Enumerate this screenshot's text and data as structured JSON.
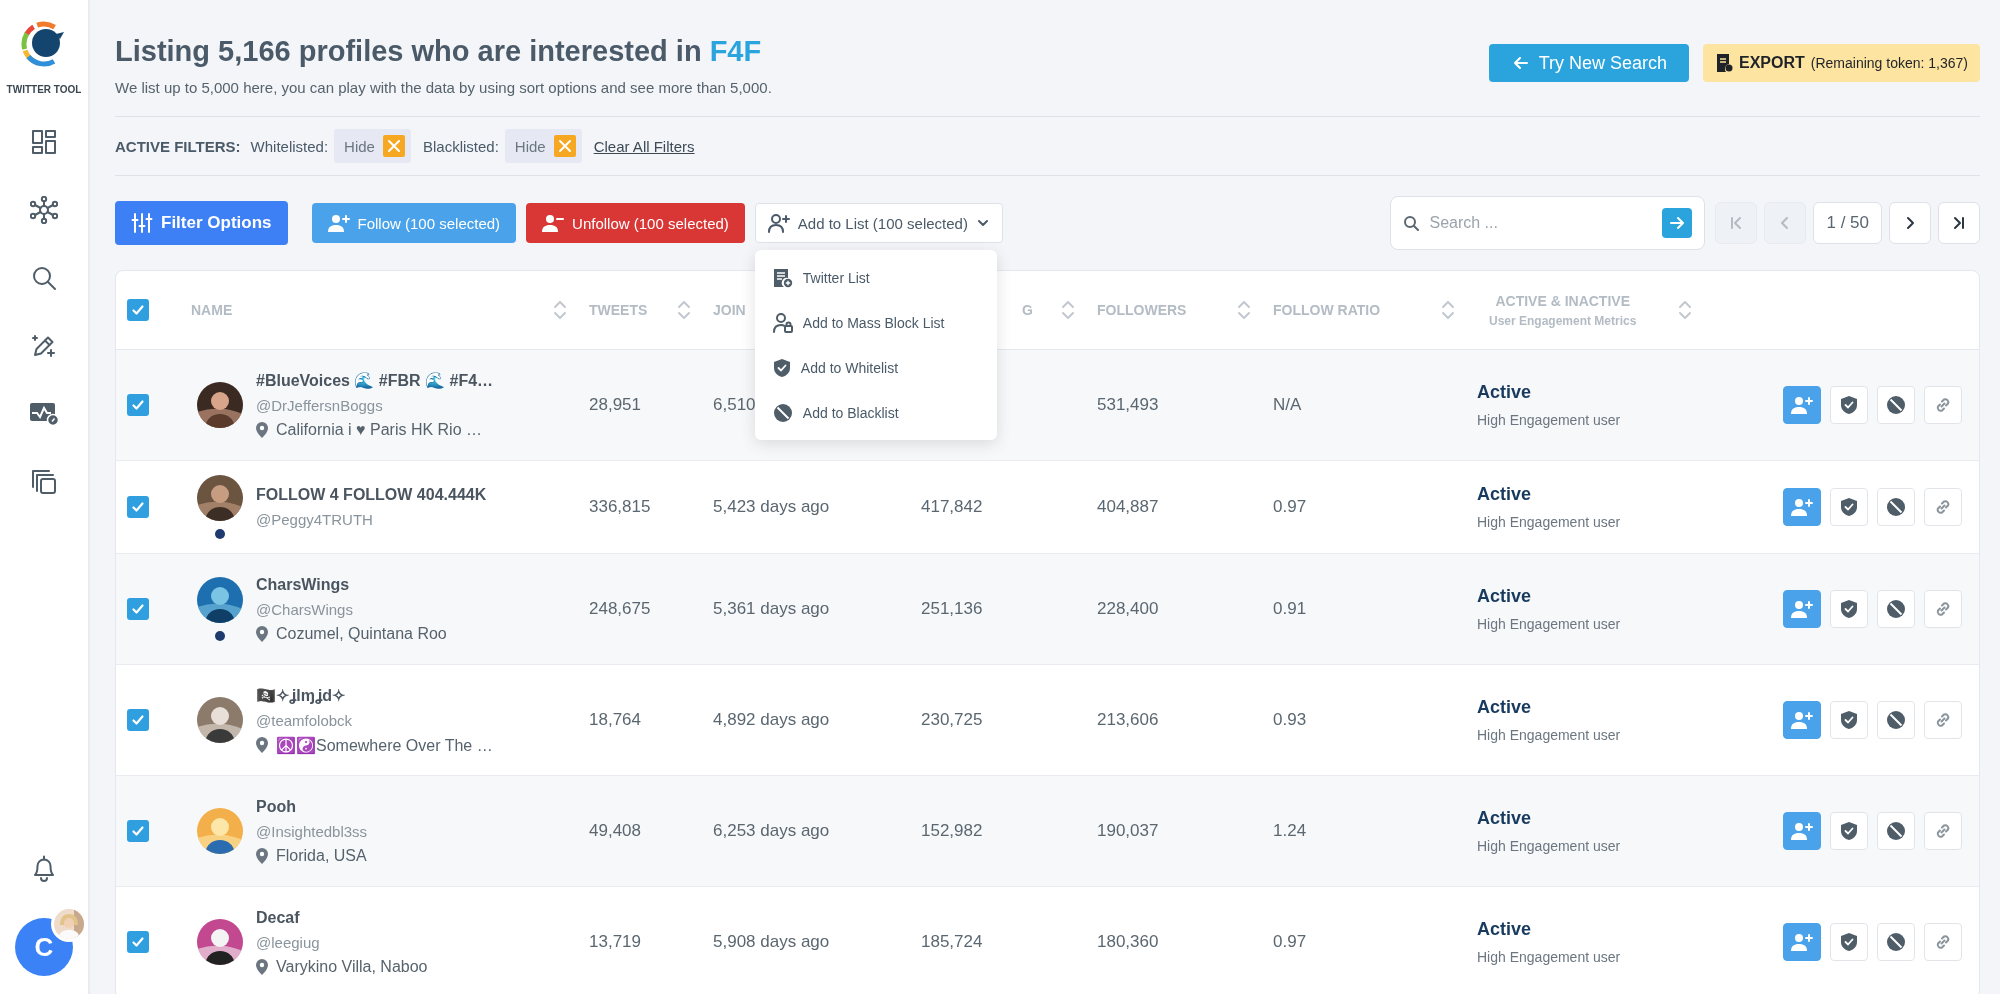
{
  "sidebar": {
    "logo_text": "TWITTER TOOL",
    "user": {
      "initial": "C"
    }
  },
  "header": {
    "title": "Listing 5,166 profiles who are interested in **F4F**",
    "subtitle": "We list up to 5,000 here, you can play with the data by using sort options and see more than 5,000.",
    "try_new_search": "Try New Search",
    "export": {
      "label": "EXPORT",
      "note": "(Remaining token: 1,367)"
    }
  },
  "filters": {
    "label": "ACTIVE FILTERS:",
    "items": [
      {
        "name": "Whitelisted:",
        "value": "Hide"
      },
      {
        "name": "Blacklisted:",
        "value": "Hide"
      }
    ],
    "clear": "Clear All Filters"
  },
  "toolbar": {
    "filter_options": "Filter Options",
    "follow": "Follow (100 selected)",
    "unfollow": "Unfollow (100 selected)",
    "add_to_list": "Add to List (100 selected)",
    "search": {
      "placeholder": "Search ..."
    },
    "pagination": {
      "first": {
        "disabled": true
      },
      "prev": {
        "disabled": true
      },
      "page": "1 / 50",
      "next": {
        "disabled": false
      },
      "last": {
        "disabled": false
      }
    }
  },
  "menu": {
    "items": [
      {
        "label": "Twitter List",
        "kind": "list"
      },
      {
        "label": "Add to Mass Block List",
        "kind": "block-user"
      },
      {
        "label": "Add to Whitelist",
        "kind": "shield"
      },
      {
        "label": "Add to Blacklist",
        "kind": "ban"
      }
    ]
  },
  "table": {
    "select_all": {
      "checked": true
    },
    "columns": [
      {
        "label": "NAME"
      },
      {
        "label": "TWEETS"
      },
      {
        "label": "JOIN"
      },
      {
        "label": "G"
      },
      {
        "label": "FOLLOWERS"
      },
      {
        "label": "FOLLOW RATIO"
      },
      {
        "label": "ACTIVE & INACTIVE",
        "sublabel": "User Engagement Metrics"
      }
    ],
    "rows": [
      {
        "checked": true,
        "dot": false,
        "name": "#BlueVoices 🌊 #FBR 🌊 #F4…",
        "handle": "@DrJeffersnBoggs",
        "location": "California i ♥ Paris HK Rio …",
        "tweets": "28,951",
        "joined": "6,510",
        "followers": "531,493",
        "ratio": "N/A",
        "status": "Active",
        "engagement": "High Engagement user"
      },
      {
        "checked": true,
        "dot": true,
        "name": "FOLLOW 4 FOLLOW 404.444K",
        "handle": "@Peggy4TRUTH",
        "tweets": "336,815",
        "joined": "5,423 days ago",
        "following": "417,842",
        "followers": "404,887",
        "ratio": "0.97",
        "status": "Active",
        "engagement": "High Engagement user"
      },
      {
        "checked": true,
        "dot": true,
        "name": "CharsWings",
        "handle": "@CharsWings",
        "location": "Cozumel, Quintana Roo",
        "tweets": "248,675",
        "joined": "5,361 days ago",
        "following": "251,136",
        "followers": "228,400",
        "ratio": "0.91",
        "status": "Active",
        "engagement": "High Engagement user"
      },
      {
        "checked": true,
        "dot": false,
        "name": "🏴‍☠️✧ʝlɱʝd✧",
        "handle": "@teamfolobck",
        "location": "☮️☯️Somewhere Over The …",
        "tweets": "18,764",
        "joined": "4,892 days ago",
        "following": "230,725",
        "followers": "213,606",
        "ratio": "0.93",
        "status": "Active",
        "engagement": "High Engagement user"
      },
      {
        "checked": true,
        "dot": false,
        "name": "Pooh",
        "handle": "@Insightedbl3ss",
        "location": "Florida, USA",
        "tweets": "49,408",
        "joined": "6,253 days ago",
        "following": "152,982",
        "followers": "190,037",
        "ratio": "1.24",
        "status": "Active",
        "engagement": "High Engagement user"
      },
      {
        "checked": true,
        "dot": false,
        "name": "Decaf",
        "handle": "@leegiug",
        "location": "Varykino Villa, Naboo",
        "tweets": "13,719",
        "joined": "5,908 days ago",
        "following": "185,724",
        "followers": "180,360",
        "ratio": "0.97",
        "status": "Active",
        "engagement": "High Engagement user"
      }
    ]
  }
}
